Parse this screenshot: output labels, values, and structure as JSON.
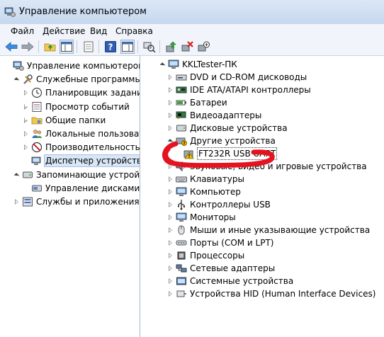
{
  "window": {
    "title": "Управление компьютером"
  },
  "menu": [
    "Файл",
    "Действие",
    "Вид",
    "Справка"
  ],
  "left_tree": [
    {
      "label": "Управление компьютером (л",
      "level": 0,
      "exp": "none",
      "icon": "computer-management-icon"
    },
    {
      "label": "Служебные программы",
      "level": 1,
      "exp": "open",
      "icon": "tools-icon"
    },
    {
      "label": "Планировщик заданий",
      "level": 2,
      "exp": "closed",
      "icon": "clock-icon"
    },
    {
      "label": "Просмотр событий",
      "level": 2,
      "exp": "closed",
      "icon": "event-viewer-icon"
    },
    {
      "label": "Общие папки",
      "level": 2,
      "exp": "closed",
      "icon": "shared-folder-icon"
    },
    {
      "label": "Локальные пользовате",
      "level": 2,
      "exp": "closed",
      "icon": "users-icon"
    },
    {
      "label": "Производительность",
      "level": 2,
      "exp": "closed",
      "icon": "performance-icon"
    },
    {
      "label": "Диспетчер устройств",
      "level": 2,
      "exp": "none",
      "icon": "device-manager-icon",
      "selected": true
    },
    {
      "label": "Запоминающие устройст",
      "level": 1,
      "exp": "open",
      "icon": "storage-icon"
    },
    {
      "label": "Управление дисками",
      "level": 2,
      "exp": "none",
      "icon": "disk-management-icon"
    },
    {
      "label": "Службы и приложения",
      "level": 1,
      "exp": "closed",
      "icon": "services-icon"
    }
  ],
  "right_tree": [
    {
      "label": "KKLTester-ПК",
      "level": 0,
      "exp": "open",
      "icon": "computer-icon"
    },
    {
      "label": "DVD и CD-ROM дисководы",
      "level": 1,
      "exp": "closed",
      "icon": "dvd-icon"
    },
    {
      "label": "IDE ATA/ATAPI контроллеры",
      "level": 1,
      "exp": "closed",
      "icon": "ide-controller-icon"
    },
    {
      "label": "Батареи",
      "level": 1,
      "exp": "closed",
      "icon": "battery-icon"
    },
    {
      "label": "Видеоадаптеры",
      "level": 1,
      "exp": "closed",
      "icon": "display-adapter-icon"
    },
    {
      "label": "Дисковые устройства",
      "level": 1,
      "exp": "closed",
      "icon": "disk-drive-icon"
    },
    {
      "label": "Другие устройства",
      "level": 1,
      "exp": "open",
      "icon": "other-devices-icon"
    },
    {
      "label": "FT232R USB UART",
      "level": 2,
      "exp": "none",
      "icon": "warning-device-icon",
      "framed": true
    },
    {
      "label": "Звуковые, видео и игровые устройства",
      "level": 1,
      "exp": "closed",
      "icon": "sound-icon"
    },
    {
      "label": "Клавиатуры",
      "level": 1,
      "exp": "closed",
      "icon": "keyboard-icon"
    },
    {
      "label": "Компьютер",
      "level": 1,
      "exp": "closed",
      "icon": "monitor-icon"
    },
    {
      "label": "Контроллеры USB",
      "level": 1,
      "exp": "closed",
      "icon": "usb-icon"
    },
    {
      "label": "Мониторы",
      "level": 1,
      "exp": "closed",
      "icon": "monitor-icon"
    },
    {
      "label": "Мыши и иные указывающие устройства",
      "level": 1,
      "exp": "closed",
      "icon": "mouse-icon"
    },
    {
      "label": "Порты (COM и LPT)",
      "level": 1,
      "exp": "closed",
      "icon": "port-icon"
    },
    {
      "label": "Процессоры",
      "level": 1,
      "exp": "closed",
      "icon": "cpu-icon"
    },
    {
      "label": "Сетевые адаптеры",
      "level": 1,
      "exp": "closed",
      "icon": "network-icon"
    },
    {
      "label": "Системные устройства",
      "level": 1,
      "exp": "closed",
      "icon": "system-device-icon"
    },
    {
      "label": "Устройства HID (Human Interface Devices)",
      "level": 1,
      "exp": "closed",
      "icon": "hid-icon"
    }
  ],
  "colors": {
    "annotation_red": "#e3141f",
    "selection": "#d9e6f6"
  }
}
